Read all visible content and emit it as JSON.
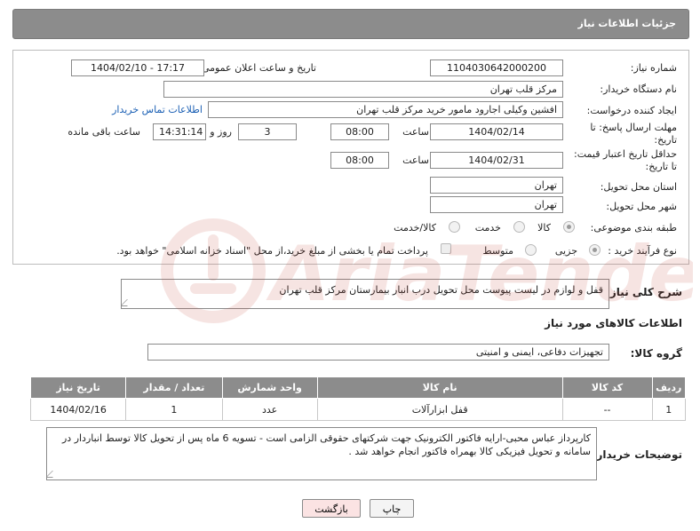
{
  "header": {
    "title": "جزئیات اطلاعات نیاز"
  },
  "form": {
    "need_number": {
      "label": "شماره نیاز:",
      "value": "1104030642000200"
    },
    "announce_datetime": {
      "label": "تاریخ و ساعت اعلان عمومی:",
      "value": "1404/02/10 - 17:17"
    },
    "buyer_org": {
      "label": "نام دستگاه خریدار:",
      "value": "مرکز قلب تهران"
    },
    "requester": {
      "label": "ایجاد کننده درخواست:",
      "value": "افشین وکیلی اجارود مامور خرید مرکز قلب تهران",
      "contact_link": "اطلاعات تماس خریدار"
    },
    "reply_deadline": {
      "label_line1": "مهلت ارسال پاسخ: تا",
      "label_line2": "تاریخ:",
      "date": "1404/02/14",
      "time_label": "ساعت",
      "time": "08:00",
      "days": "3",
      "days_label": "روز و",
      "remaining": "14:31:14",
      "remaining_label": "ساعت باقی مانده"
    },
    "price_validity": {
      "label_line1": "حداقل تاریخ اعتبار قیمت:",
      "label_line2": "تا تاریخ:",
      "date": "1404/02/31",
      "time_label": "ساعت",
      "time": "08:00"
    },
    "delivery_province": {
      "label": "استان محل تحویل:",
      "value": "تهران"
    },
    "delivery_city": {
      "label": "شهر محل تحویل:",
      "value": "تهران"
    },
    "category": {
      "label": "طبقه بندی موضوعی:",
      "options": [
        "کالا",
        "خدمت",
        "کالا/خدمت"
      ],
      "selected": "کالا"
    },
    "purchase_type": {
      "label": "نوع فرآیند خرید :",
      "options": [
        "جزیی",
        "متوسط"
      ],
      "selected": "جزیی",
      "treasury_note": "پرداخت تمام یا بخشی از مبلغ خرید،از محل \"اسناد خزانه اسلامی\" خواهد بود."
    }
  },
  "description": {
    "label": "شرح کلی نیاز:",
    "value": "قفل و لوازم در لیست پیوست محل تحویل درب انبار بیمارستان مرکز قلب تهران"
  },
  "goods_section": {
    "title": "اطلاعات کالاهای مورد نیاز"
  },
  "goods_group": {
    "label": "گروه کالا:",
    "value": "تجهیزات دفاعی، ایمنی و امنیتی"
  },
  "goods_table": {
    "headers": [
      "ردیف",
      "کد کالا",
      "نام کالا",
      "واحد شمارش",
      "تعداد / مقدار",
      "تاریخ نیاز"
    ],
    "rows": [
      [
        "1",
        "--",
        "قفل ابزارآلات",
        "عدد",
        "1",
        "1404/02/16"
      ]
    ]
  },
  "buyer_notes": {
    "label": "توضیحات خریدار:",
    "value": "کارپرداز عباس محبی-ارایه فاکتور الکترونیک جهت شرکتهای حقوقی الزامی است - تسویه 6 ماه پس از تحویل کالا توسط انباردار در سامانه و تحویل فیزیکی کالا بهمراه فاکتور انجام خواهد شد ."
  },
  "buttons": {
    "print": "چاپ",
    "back": "بازگشت"
  },
  "colors": {
    "header_bg": "#8c8c8c",
    "link": "#1a5fb4",
    "back_button_bg": "#fbe3e3",
    "watermark": "#c0392b"
  }
}
